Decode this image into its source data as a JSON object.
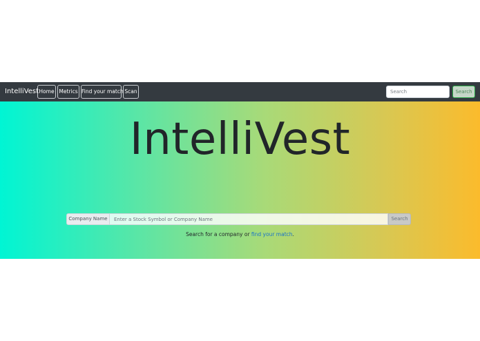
{
  "navbar": {
    "brand": "IntelliVest",
    "items": [
      {
        "label": "Home"
      },
      {
        "label": "Metrics"
      },
      {
        "label": "Find your match"
      },
      {
        "label": "Scan"
      }
    ],
    "search": {
      "placeholder": "Search",
      "button_label": "Search"
    }
  },
  "hero": {
    "title": "IntelliVest",
    "company_search": {
      "prepend_label": "Company Name",
      "placeholder": "Enter a Stock Symbol or Company Name",
      "button_label": "Search"
    },
    "helper": {
      "prefix": "Search for a company or ",
      "link_text": "find your match",
      "suffix": "."
    }
  },
  "colors": {
    "navbar_bg": "#343a40",
    "gradient_start": "#00f5d4",
    "gradient_end": "#fbbb2c",
    "link": "#1a73c8",
    "search_button_outline": "#28a745"
  }
}
